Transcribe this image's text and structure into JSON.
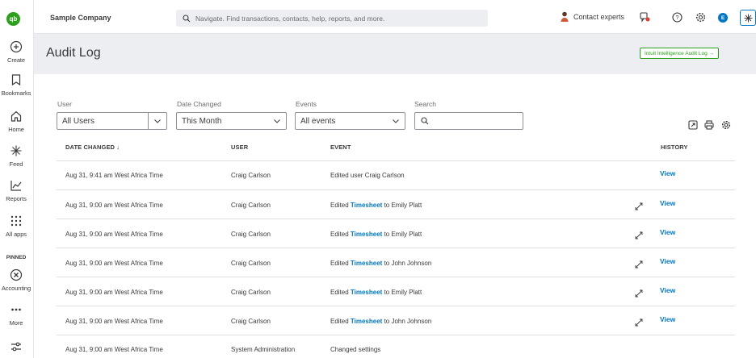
{
  "nav": {
    "logo": "qb",
    "items": [
      {
        "label": "Create"
      },
      {
        "label": "Bookmarks"
      },
      {
        "label": "Home"
      },
      {
        "label": "Feed"
      },
      {
        "label": "Reports"
      },
      {
        "label": "All apps"
      },
      {
        "label": "Accounting"
      },
      {
        "label": "More"
      }
    ],
    "pinned": "PINNED"
  },
  "topbar": {
    "company": "Sample Company",
    "search_placeholder": "Navigate. Find transactions, contacts, help, reports, and more.",
    "contact_label": "Contact experts",
    "avatar_initial": "E"
  },
  "header": {
    "title": "Audit Log",
    "intuit_button": "Intuit Intelligence Audit Log →"
  },
  "filters": {
    "user_label": "User",
    "user_value": "All Users",
    "date_label": "Date Changed",
    "date_value": "This Month",
    "events_label": "Events",
    "events_value": "All events",
    "search_label": "Search"
  },
  "table": {
    "headers": {
      "date": "DATE CHANGED ↓",
      "user": "USER",
      "event": "EVENT",
      "history": "HISTORY"
    },
    "rows": [
      {
        "date": "Aug 31, 9:41 am West Africa Time",
        "user": "Craig Carlson",
        "event_pre": "Edited user Craig Carlson",
        "event_link": "",
        "event_post": "",
        "view": "View"
      },
      {
        "date": "Aug 31, 9:00 am West Africa Time",
        "user": "Craig Carlson",
        "event_pre": "Edited ",
        "event_link": "Timesheet",
        "event_post": " to Emily Platt",
        "view": "View"
      },
      {
        "date": "Aug 31, 9:00 am West Africa Time",
        "user": "Craig Carlson",
        "event_pre": "Edited ",
        "event_link": "Timesheet",
        "event_post": " to Emily Platt",
        "view": "View"
      },
      {
        "date": "Aug 31, 9:00 am West Africa Time",
        "user": "Craig Carlson",
        "event_pre": "Edited ",
        "event_link": "Timesheet",
        "event_post": " to John Johnson",
        "view": "View"
      },
      {
        "date": "Aug 31, 9:00 am West Africa Time",
        "user": "Craig Carlson",
        "event_pre": "Edited ",
        "event_link": "Timesheet",
        "event_post": " to Emily Platt",
        "view": "View"
      },
      {
        "date": "Aug 31, 9:00 am West Africa Time",
        "user": "Craig Carlson",
        "event_pre": "Edited ",
        "event_link": "Timesheet",
        "event_post": " to John Johnson",
        "view": "View"
      },
      {
        "date": "Aug 31, 9:00 am West Africa Time",
        "user": "System Administration",
        "event_pre": "Changed settings",
        "event_link": "",
        "event_post": "",
        "view": ""
      }
    ]
  },
  "colors": {
    "brand_green": "#2ca01c",
    "link_blue": "#0077c5",
    "header_bg": "#eceef1"
  }
}
